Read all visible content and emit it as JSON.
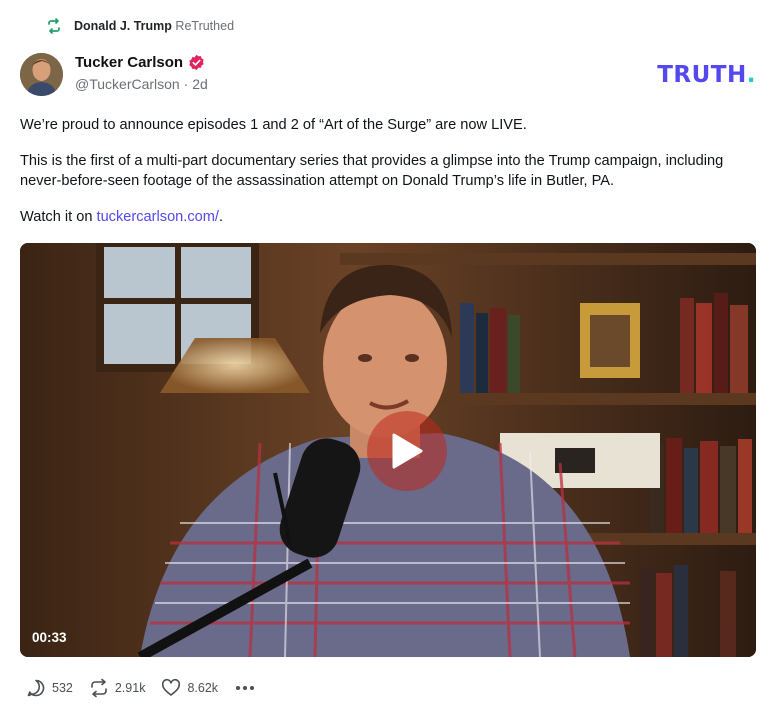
{
  "retruth": {
    "user": "Donald J. Trump",
    "label": "ReTruthed",
    "icon": "retruth-icon"
  },
  "post": {
    "author_name": "Tucker Carlson",
    "verified": true,
    "handle": "@TuckerCarlson",
    "time_sep": " · ",
    "time": "2d",
    "paragraph1": "We’re proud to announce episodes 1 and 2 of “Art of the Surge” are now LIVE.",
    "paragraph2": "This is the first of a multi-part documentary series that provides a glimpse into the Trump campaign, including never-before-seen footage of the assassination attempt on Donald Trump’s life in Butler, PA.",
    "paragraph3_prefix": "Watch it on ",
    "link_text": "tuckercarlson.com/",
    "paragraph3_suffix": "."
  },
  "brand": {
    "word": "TRUTH",
    "dot": ".",
    "color": "#5448ee",
    "dot_color": "#1fd0b1"
  },
  "video": {
    "duration": "00:33",
    "play_icon": "play-icon"
  },
  "actions": {
    "replies": "532",
    "retruths": "2.91k",
    "likes": "8.62k",
    "more_icon": "more-icon"
  }
}
